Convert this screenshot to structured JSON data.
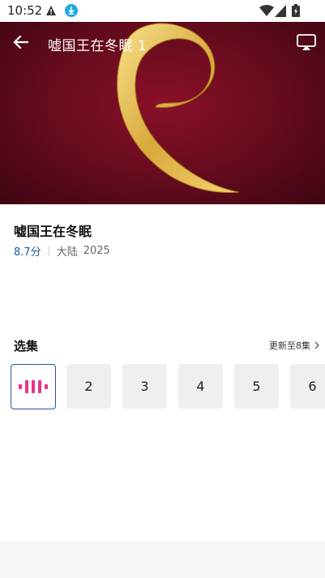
{
  "status": {
    "time": "10:52"
  },
  "player": {
    "title": "嘘国王在冬眠 1"
  },
  "info": {
    "title": "嘘国王在冬眠",
    "rating": "8.7分",
    "region": "大陆",
    "year": "2025"
  },
  "episodes": {
    "title": "选集",
    "update_text": "更新至8集",
    "items": [
      "2",
      "3",
      "4",
      "5",
      "6"
    ]
  }
}
